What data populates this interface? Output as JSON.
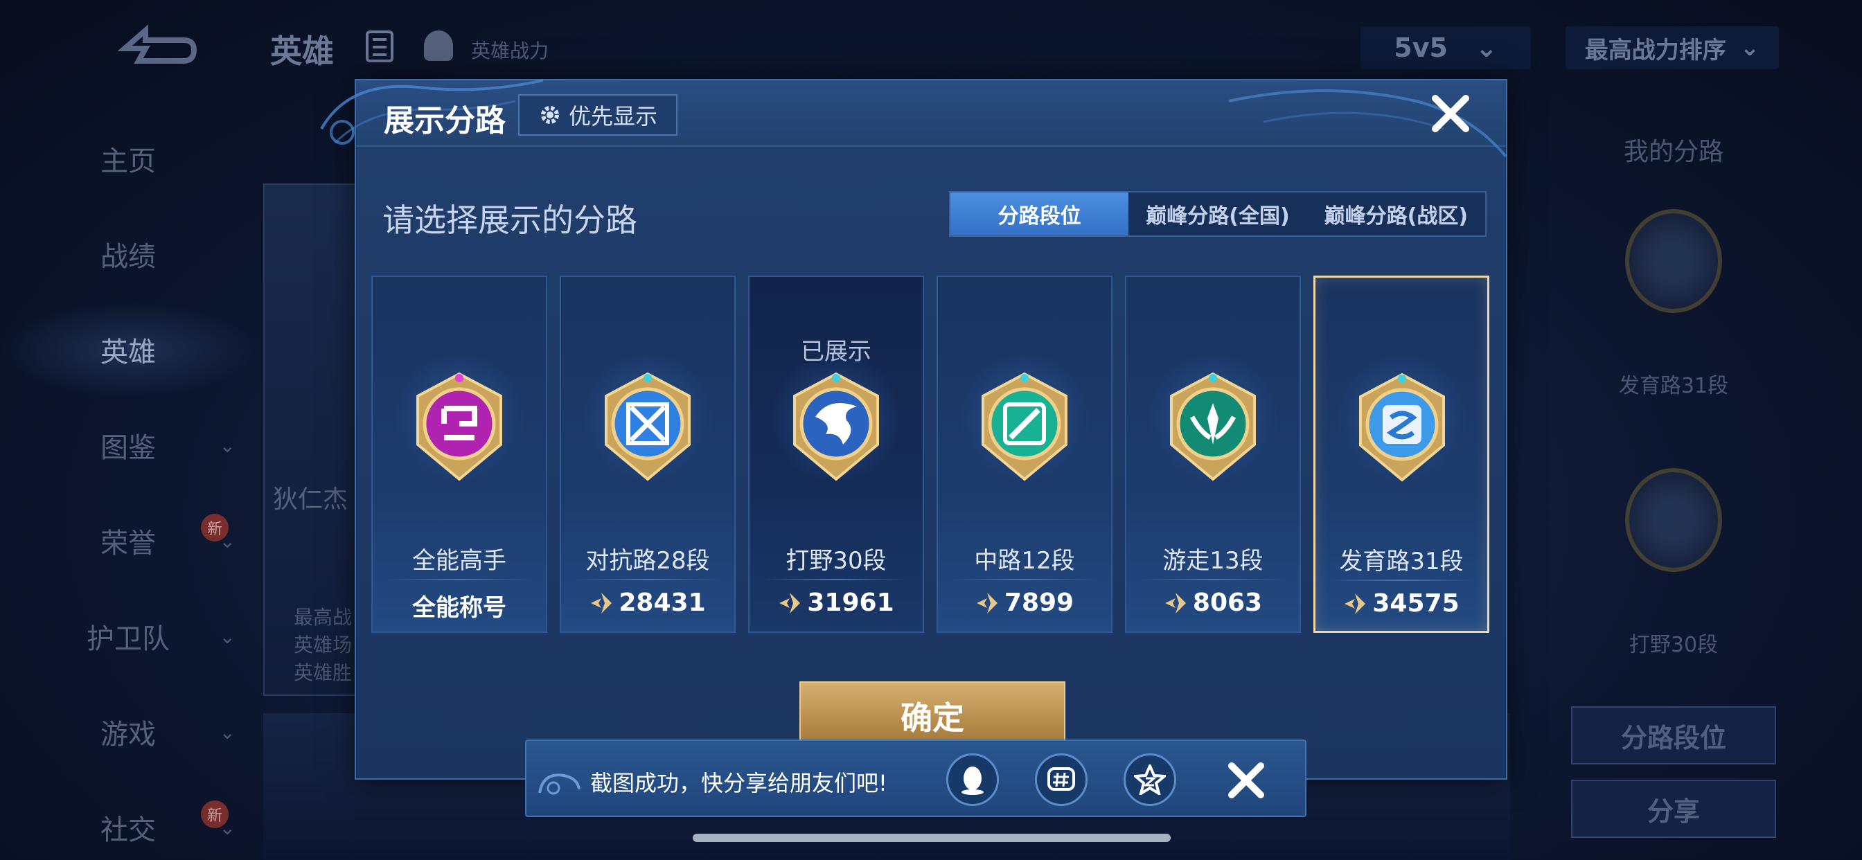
{
  "background": {
    "title": "英雄",
    "subtitle": "英雄战力",
    "mode": "5v5",
    "sort": "最高战力排序",
    "nav": [
      {
        "label": "主页",
        "chevron": false,
        "badge": ""
      },
      {
        "label": "战绩",
        "chevron": false,
        "badge": ""
      },
      {
        "label": "英雄",
        "chevron": false,
        "badge": "",
        "active": true
      },
      {
        "label": "图鉴",
        "chevron": true,
        "badge": ""
      },
      {
        "label": "荣誉",
        "chevron": true,
        "badge": "新"
      },
      {
        "label": "护卫队",
        "chevron": true,
        "badge": ""
      },
      {
        "label": "游戏",
        "chevron": true,
        "badge": ""
      },
      {
        "label": "社交",
        "chevron": true,
        "badge": "新"
      }
    ],
    "hero_name": "狄仁杰",
    "hero_lines": [
      "最高战",
      "英雄场",
      "英雄胜"
    ],
    "right_panel": {
      "title": "我的分路",
      "lane1": "发育路31段",
      "lane2": "打野30段",
      "btn1": "分路段位",
      "btn2": "分享"
    }
  },
  "modal": {
    "title": "展示分路",
    "priority_label": "优先显示",
    "subtitle": "请选择展示的分路",
    "tabs": [
      "分路段位",
      "巅峰分路(全国)",
      "巅峰分路(战区)"
    ],
    "active_tab": 0,
    "cards": [
      {
        "rank": "全能高手",
        "score": "全能称号",
        "shown_label": "",
        "emblem": "allround-emblem-icon",
        "color": "#c030c0",
        "has_power_icon": false
      },
      {
        "rank": "对抗路28段",
        "score": "28431",
        "shown_label": "",
        "emblem": "clash-lane-emblem-icon",
        "color": "#3a8fe8",
        "has_power_icon": true
      },
      {
        "rank": "打野30段",
        "score": "31961",
        "shown_label": "已展示",
        "emblem": "jungle-emblem-icon",
        "color": "#3a76d0",
        "has_power_icon": true
      },
      {
        "rank": "中路12段",
        "score": "7899",
        "shown_label": "",
        "emblem": "mid-lane-emblem-icon",
        "color": "#23b99a",
        "has_power_icon": true
      },
      {
        "rank": "游走13段",
        "score": "8063",
        "shown_label": "",
        "emblem": "roam-emblem-icon",
        "color": "#1f9f86",
        "has_power_icon": true
      },
      {
        "rank": "发育路31段",
        "score": "34575",
        "shown_label": "",
        "emblem": "farm-lane-emblem-icon",
        "color": "#4aa8f0",
        "has_power_icon": true,
        "selected": true
      }
    ],
    "confirm_label": "确定"
  },
  "toast": {
    "text": "截图成功，快分享给朋友们吧!",
    "share_icons": [
      "qq-icon",
      "hashtag-icon",
      "qzone-icon"
    ]
  },
  "colors": {
    "gold": "#d5b071",
    "selected_border": "#f2d7a7",
    "active_tab": "#3f82d8"
  }
}
